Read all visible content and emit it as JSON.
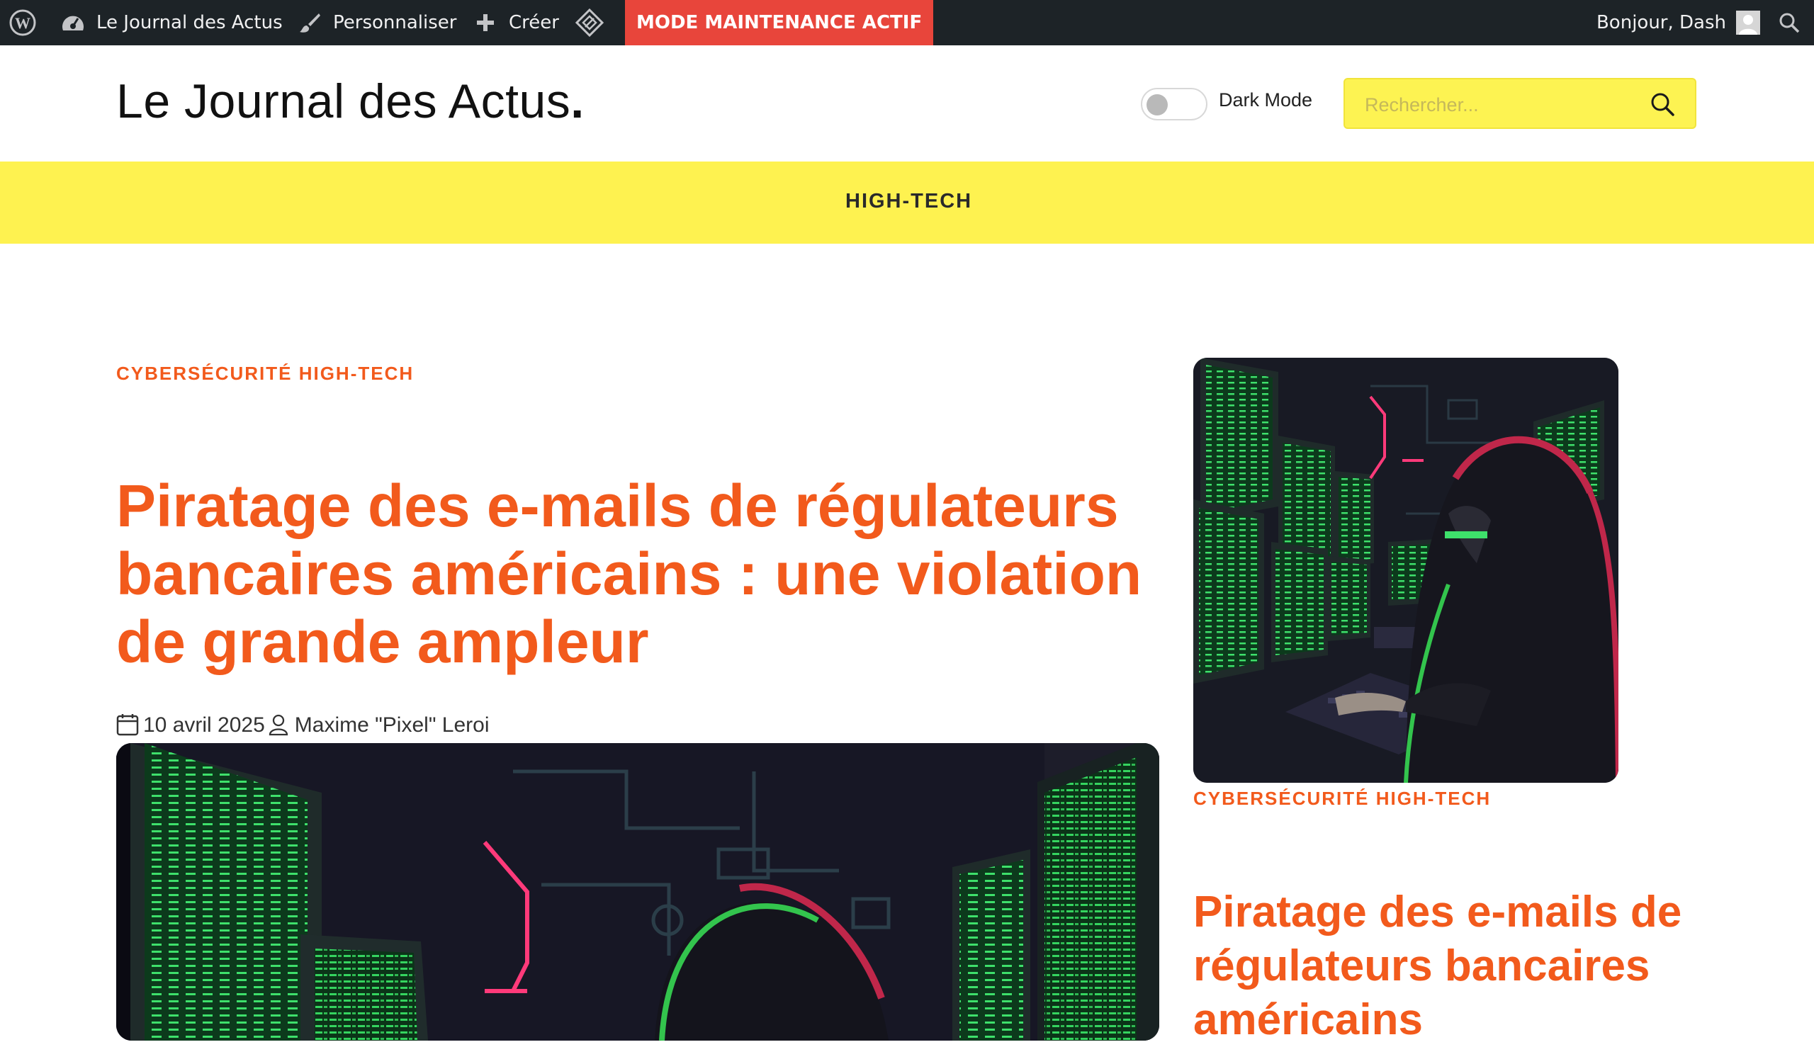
{
  "adminbar": {
    "site_name": "Le Journal des Actus",
    "customize": "Personnaliser",
    "new": "Créer",
    "maintenance": "MODE MAINTENANCE ACTIF",
    "greeting": "Bonjour, Dash",
    "icons": [
      "wordpress-logo-icon",
      "dashboard-icon",
      "paintbrush-icon",
      "plus-icon",
      "diamond-icon",
      "avatar-icon",
      "search-icon"
    ]
  },
  "header": {
    "site_title": "Le Journal des Actus",
    "title_dot": ".",
    "dark_mode_label": "Dark Mode",
    "dark_mode_on": false,
    "search_placeholder": "Rechercher..."
  },
  "nav": {
    "items": [
      {
        "label": "HIGH-TECH"
      }
    ]
  },
  "colors": {
    "accent": "#f25a1c",
    "nav_bg": "#fef250",
    "search_bg": "#fdf352",
    "adminbar_bg": "#1d2327",
    "maintenance_bg": "#e8453b"
  },
  "main_article": {
    "categories": "CYBERSÉCURITÉ HIGH-TECH",
    "title": "Piratage des e-mails de régulateurs bancaires américains : une violation de grande ampleur",
    "date": "10 avril 2025",
    "author": "Maxime \"Pixel\" Leroi",
    "image_subject": "hooded hacker in front of green code monitors with red neon lights"
  },
  "sidebar_post": {
    "categories": "CYBERSÉCURITÉ HIGH-TECH",
    "title": "Piratage des e-mails de régulateurs bancaires américains",
    "image_subject": "hooded hacker typing at keyboard surrounded by green code monitors"
  }
}
